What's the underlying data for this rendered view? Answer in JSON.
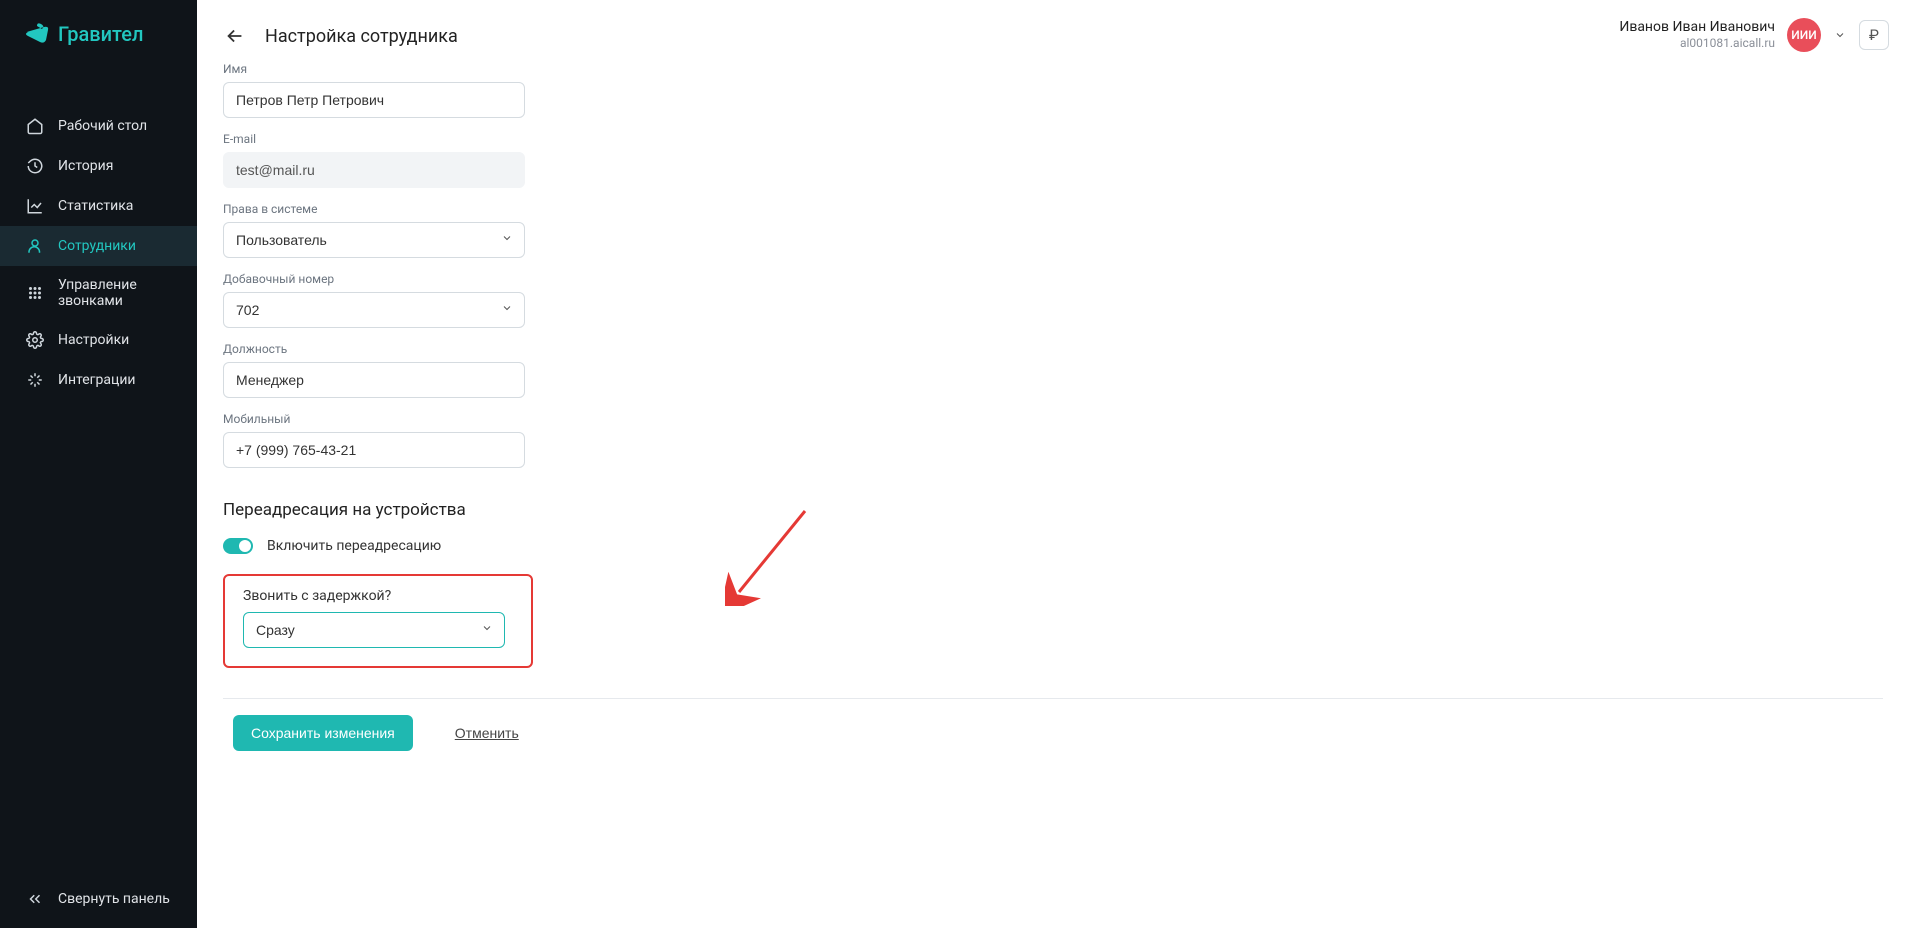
{
  "brand": "Гравител",
  "sidebar": {
    "items": [
      {
        "label": "Рабочий стол"
      },
      {
        "label": "История"
      },
      {
        "label": "Статистика"
      },
      {
        "label": "Сотрудники"
      },
      {
        "label": "Управление звонками"
      },
      {
        "label": "Настройки"
      },
      {
        "label": "Интеграции"
      }
    ],
    "collapse_label": "Свернуть панель"
  },
  "header": {
    "user_name": "Иванов Иван Иванович",
    "user_domain": "al001081.aicall.ru",
    "avatar_initials": "ИИИ",
    "currency": "₽"
  },
  "page": {
    "title": "Настройка сотрудника",
    "labels": {
      "name": "Имя",
      "email": "E-mail",
      "rights": "Права в системе",
      "ext": "Добавочный номер",
      "position": "Должность",
      "mobile": "Мобильный",
      "redirect_section": "Переадресация на устройства",
      "enable_redirect": "Включить переадресацию",
      "delay_question": "Звонить с задержкой?"
    },
    "values": {
      "name": "Петров Петр Петрович",
      "email": "test@mail.ru",
      "rights": "Пользователь",
      "ext": "702",
      "position": "Менеджер",
      "mobile": "+7 (999) 765-43-21",
      "delay": "Сразу"
    },
    "actions": {
      "save": "Сохранить изменения",
      "cancel": "Отменить"
    }
  }
}
